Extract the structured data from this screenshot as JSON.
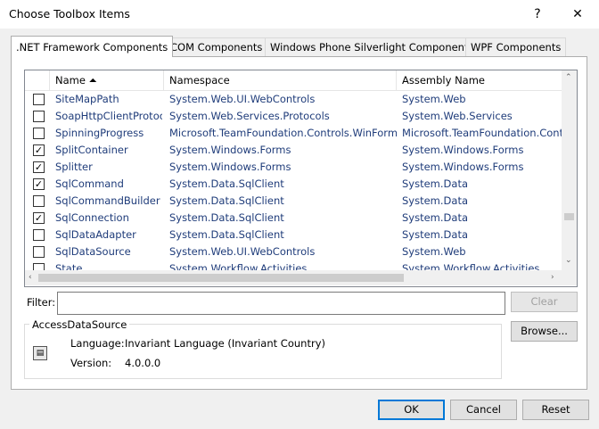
{
  "window": {
    "title": "Choose Toolbox Items",
    "help_label": "?",
    "close_label": "✕"
  },
  "tabs": [
    {
      "label": ".NET Framework Components"
    },
    {
      "label": "COM Components"
    },
    {
      "label": "Windows Phone Silverlight Components"
    },
    {
      "label": "WPF Components"
    }
  ],
  "list": {
    "columns": [
      {
        "label": "Name ⏶"
      },
      {
        "label": "Namespace"
      },
      {
        "label": "Assembly Name"
      }
    ],
    "rows": [
      {
        "checked": false,
        "name": "SiteMapPath",
        "namespace": "System.Web.UI.WebControls",
        "assembly": "System.Web"
      },
      {
        "checked": false,
        "name": "SoapHttpClientProtoc",
        "namespace": "System.Web.Services.Protocols",
        "assembly": "System.Web.Services"
      },
      {
        "checked": false,
        "name": "SpinningProgress",
        "namespace": "Microsoft.TeamFoundation.Controls.WinForms",
        "assembly": "Microsoft.TeamFoundation.Contr"
      },
      {
        "checked": true,
        "name": "SplitContainer",
        "namespace": "System.Windows.Forms",
        "assembly": "System.Windows.Forms"
      },
      {
        "checked": true,
        "name": "Splitter",
        "namespace": "System.Windows.Forms",
        "assembly": "System.Windows.Forms"
      },
      {
        "checked": true,
        "name": "SqlCommand",
        "namespace": "System.Data.SqlClient",
        "assembly": "System.Data"
      },
      {
        "checked": false,
        "name": "SqlCommandBuilder",
        "namespace": "System.Data.SqlClient",
        "assembly": "System.Data"
      },
      {
        "checked": true,
        "name": "SqlConnection",
        "namespace": "System.Data.SqlClient",
        "assembly": "System.Data"
      },
      {
        "checked": false,
        "name": "SqlDataAdapter",
        "namespace": "System.Data.SqlClient",
        "assembly": "System.Data"
      },
      {
        "checked": false,
        "name": "SqlDataSource",
        "namespace": "System.Web.UI.WebControls",
        "assembly": "System.Web"
      },
      {
        "checked": false,
        "name": "State",
        "namespace": "System.Workflow.Activities",
        "assembly": "System.Workflow.Activities"
      }
    ]
  },
  "filter": {
    "label": "Filter:",
    "value": "",
    "clear_label": "Clear"
  },
  "details": {
    "title": "AccessDataSource",
    "language_label": "Language:",
    "language_value": "Invariant Language (Invariant Country)",
    "version_label": "Version:",
    "version_value": "4.0.0.0",
    "browse_label": "Browse..."
  },
  "footer": {
    "ok_label": "OK",
    "cancel_label": "Cancel",
    "reset_label": "Reset"
  },
  "colors": {
    "accent": "#0078d7",
    "cell_text": "#1f3c7a"
  }
}
